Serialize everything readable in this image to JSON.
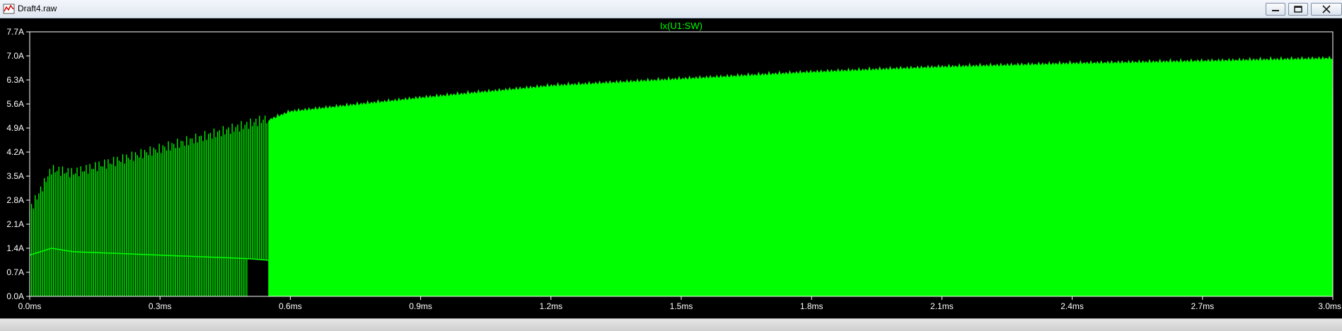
{
  "window": {
    "title": "Draft4.raw",
    "buttons": [
      "minimize",
      "restore",
      "close"
    ]
  },
  "colors": {
    "plot_background": "#000000",
    "trace": "#00ff00",
    "axis_text": "#ffffff",
    "axis_line": "#ffffff"
  },
  "chart_data": {
    "type": "area",
    "title": "Ix(U1:SW)",
    "xlabel": "",
    "ylabel": "",
    "xlim": [
      0.0,
      3.0
    ],
    "ylim": [
      0.0,
      7.7
    ],
    "x_ticks": [
      "0.0ms",
      "0.3ms",
      "0.6ms",
      "0.9ms",
      "1.2ms",
      "1.5ms",
      "1.8ms",
      "2.1ms",
      "2.4ms",
      "2.7ms",
      "3.0ms"
    ],
    "y_ticks": [
      "0.0A",
      "0.7A",
      "1.4A",
      "2.1A",
      "2.8A",
      "3.5A",
      "4.2A",
      "4.9A",
      "5.6A",
      "6.3A",
      "7.0A",
      "7.7A"
    ],
    "grid": false,
    "legend": "top-center",
    "series": [
      {
        "name": "Ix(U1:SW)",
        "x_unit": "ms",
        "y_unit": "A",
        "envelope_x": [
          0.0,
          0.05,
          0.1,
          0.2,
          0.3,
          0.4,
          0.5,
          0.55,
          0.6,
          0.9,
          1.2,
          1.5,
          1.8,
          2.1,
          2.4,
          2.7,
          3.0
        ],
        "envelope_upper": [
          2.5,
          3.7,
          3.6,
          3.95,
          4.3,
          4.65,
          5.0,
          5.2,
          5.45,
          5.85,
          6.2,
          6.4,
          6.6,
          6.75,
          6.85,
          6.92,
          7.0
        ],
        "envelope_lower": [
          1.2,
          1.4,
          1.3,
          1.25,
          1.2,
          1.15,
          1.1,
          1.05,
          0.0,
          0.0,
          0.0,
          0.0,
          0.0,
          0.0,
          0.0,
          0.0,
          0.0
        ]
      }
    ]
  }
}
